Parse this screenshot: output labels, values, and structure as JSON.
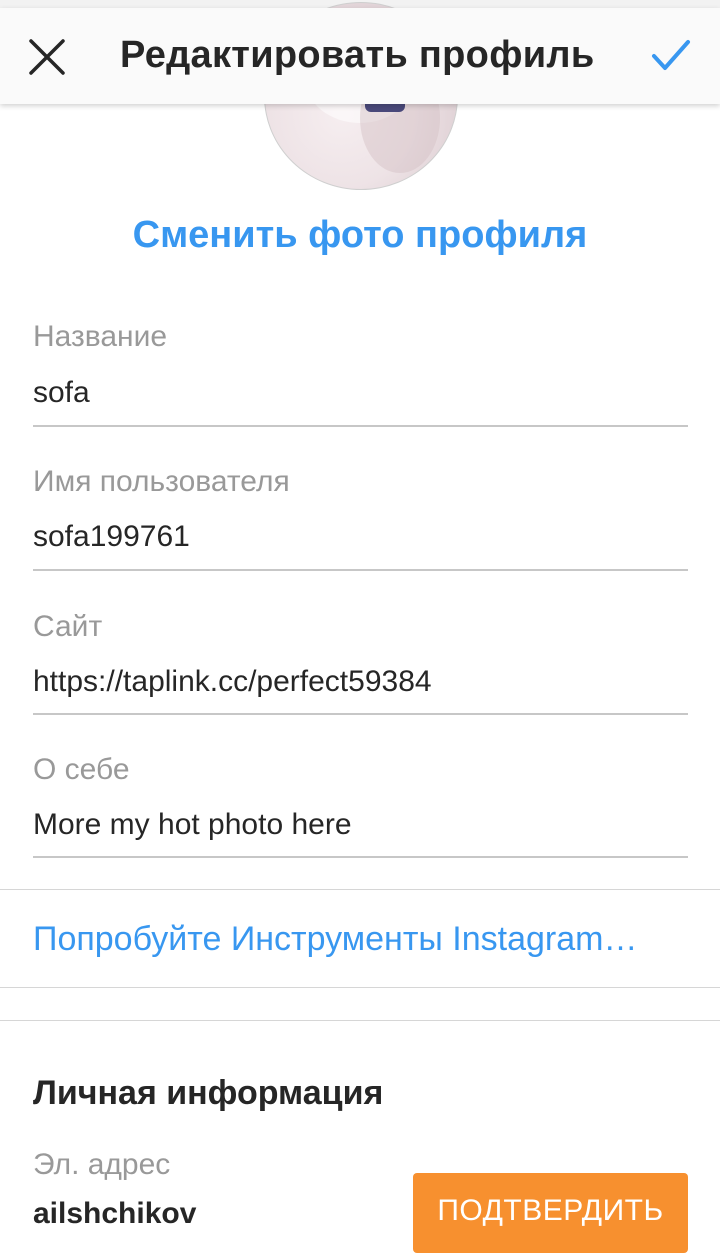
{
  "header": {
    "title": "Редактировать профиль"
  },
  "icons": {
    "close": "close-icon",
    "confirm": "checkmark-icon"
  },
  "colors": {
    "accent": "#3897f0",
    "confirm_button": "#f7902f",
    "text": "#262626",
    "label": "#999999"
  },
  "profile": {
    "change_photo_label": "Сменить фото профиля"
  },
  "fields": {
    "name": {
      "label": "Название",
      "value": "sofa"
    },
    "username": {
      "label": "Имя пользователя",
      "value": "sofa199761"
    },
    "website": {
      "label": "Сайт",
      "value": "https://taplink.cc/perfect59384"
    },
    "bio": {
      "label": "О себе",
      "value": "More my hot photo here"
    }
  },
  "tools_link": "Попробуйте Инструменты Instagram…",
  "personal_info": {
    "title": "Личная информация",
    "email_label": "Эл. адрес",
    "email_value": "ailshchikov",
    "confirm_label": "ПОДТВЕРДИТЬ"
  }
}
